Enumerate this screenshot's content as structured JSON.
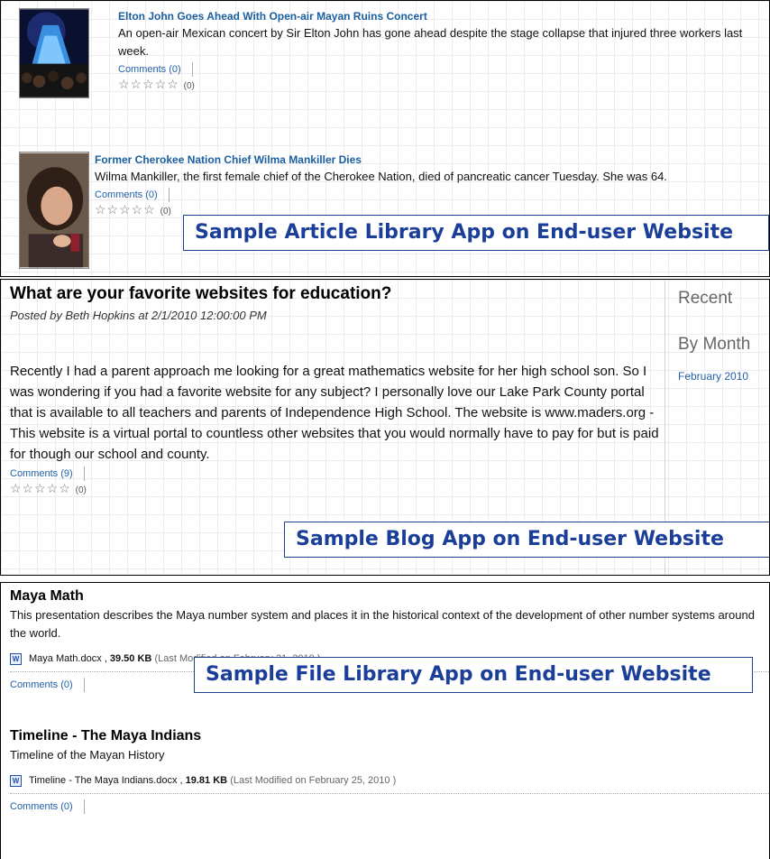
{
  "articles": {
    "items": [
      {
        "title": "Elton John Goes Ahead With Open-air Mayan Ruins Concert",
        "summary": "An open-air Mexican concert by Sir Elton John has gone ahead despite the stage collapse that injured three workers last week.",
        "comments": "Comments (0)",
        "rating_count": "(0)"
      },
      {
        "title": "Former Cherokee Nation Chief Wilma Mankiller Dies",
        "summary": "Wilma Mankiller, the first female chief of the Cherokee Nation, died of pancreatic cancer Tuesday. She was 64.",
        "comments": "Comments (0)",
        "rating_count": "(0)"
      }
    ],
    "caption": "Sample Article Library App on End-user Website"
  },
  "blog": {
    "title": "What are your favorite websites for education?",
    "meta": "Posted by Beth Hopkins at 2/1/2010 12:00:00 PM",
    "body": "Recently I had a parent approach me looking for a great mathematics website for her high school son. So I was wondering if you had a favorite website for any subject? I personally love our Lake Park County portal that is available to all teachers and parents of Independence High School. The website is www.maders.org - This website is a virtual portal to countless other websites that you would normally have to pay for but is paid for though our school and county.",
    "comments": "Comments (9)",
    "rating_count": "(0)",
    "sidebar": {
      "recent": "Recent",
      "by_month": "By Month",
      "month_link": "February 2010"
    },
    "caption": "Sample Blog App on End-user Website"
  },
  "files": {
    "items": [
      {
        "title": "Maya Math",
        "description": "This presentation describes the Maya number system and places it in the historical context of the development of other number systems around the world.",
        "filename": "Maya Math.docx ,",
        "size": "39.50 KB",
        "modified": "(Last Modified on February 21, 2010 )",
        "comments": "Comments (0)"
      },
      {
        "title": "Timeline - The Maya Indians",
        "description": "Timeline of the Mayan History",
        "filename": "Timeline - The Maya Indians.docx ,",
        "size": "19.81 KB",
        "modified": "(Last Modified on February 25, 2010 )",
        "comments": "Comments (0)"
      }
    ],
    "caption": "Sample File Library App on End-user Website"
  },
  "icons": {
    "star": "☆",
    "document": "W"
  }
}
